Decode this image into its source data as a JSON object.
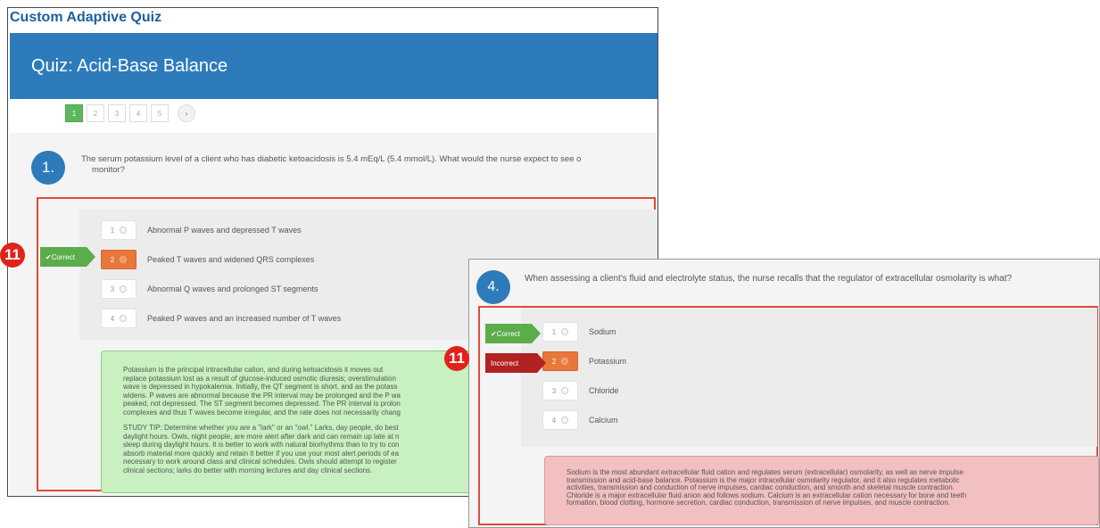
{
  "panel1": {
    "app_title": "Custom Adaptive Quiz",
    "quiz_title": "Quiz: Acid-Base Balance",
    "pages": [
      "1",
      "2",
      "3",
      "4",
      "5"
    ],
    "next_icon": "chevron-right-icon",
    "next_glyph": "›",
    "question_number": "1.",
    "question_line1": "The serum potassium level of a client who has diabetic ketoacidosis is 5.4 mEq/L (5.4 mmol/L). What would the nurse expect to see o",
    "question_line2": "monitor?",
    "correct_tag": "Correct",
    "answers": [
      {
        "num": "1",
        "label": "Abnormal P waves and depressed T waves"
      },
      {
        "num": "2",
        "label": "Peaked T waves and widened QRS complexes"
      },
      {
        "num": "3",
        "label": "Abnormal Q waves and prolonged ST segments"
      },
      {
        "num": "4",
        "label": "Peaked P waves and an increased number of T waves"
      }
    ],
    "rationale_p1": [
      "Potassium is the principal intracellular cation, and during ketoacidosis it moves out",
      "replace potassium lost as a result of glucose-induced osmotic diuresis; overstimulation",
      "wave is depressed in hypokalemia. Initially, the QT segment is short, and as the potass",
      "widens. P waves are abnormal because the PR interval may be prolonged and the P wa",
      "peaked, not depressed. The ST segment becomes depressed. The PR interval is prolon",
      "complexes and thus T waves become irregular, and the rate does not necessarily chang"
    ],
    "rationale_p2": [
      "STUDY TIP: Determine whether you are a \"lark\" or an \"owl.\" Larks, day people, do best",
      "daylight hours. Owls, night people, are more alert after dark and can remain up late at n",
      "sleep during daylight hours. It is better to work with natural biorhythms than to try to con",
      "absorb material more quickly and retain it better if you use your most alert periods of ea",
      "necessary to work around class and clinical schedules. Owls should attempt to register",
      "clinical sections; larks do better with morning lectures and day clinical sections."
    ],
    "marker": "11"
  },
  "panel2": {
    "question_number": "4.",
    "question": "When assessing a client's fluid and electrolyte status, the nurse recalls that the regulator of extracellular osmolarity is what?",
    "correct_tag": "Correct",
    "incorrect_tag": "Incorrect",
    "answers": [
      {
        "num": "1",
        "label": "Sodium"
      },
      {
        "num": "2",
        "label": "Potassium"
      },
      {
        "num": "3",
        "label": "Chloride"
      },
      {
        "num": "4",
        "label": "Calcium"
      }
    ],
    "rationale": [
      "Sodium is the most abundant extracellular fluid cation and regulates serum (extracellular) osmolarity, as well as nerve impulse",
      "transmission and acid-base balance. Potassium is the major intracellular osmolarity regulator, and it also regulates metabolic",
      "activities, transmission and conduction of nerve impulses, cardiac conduction, and smooth and skeletal muscle contraction.",
      "Chloride is a major extracellular fluid anion and follows sodium. Calcium is an extracellular cation necessary for bone and teeth",
      "formation, blood clotting, hormone secretion, cardiac conduction, transmission of nerve impulses, and muscle contraction."
    ],
    "marker": "11"
  },
  "colors": {
    "brand_blue": "#2d7bbb",
    "correct_green": "#5aad4a",
    "incorrect_red": "#b22222",
    "selected_orange": "#e8773a",
    "marker_red": "#e02218"
  }
}
